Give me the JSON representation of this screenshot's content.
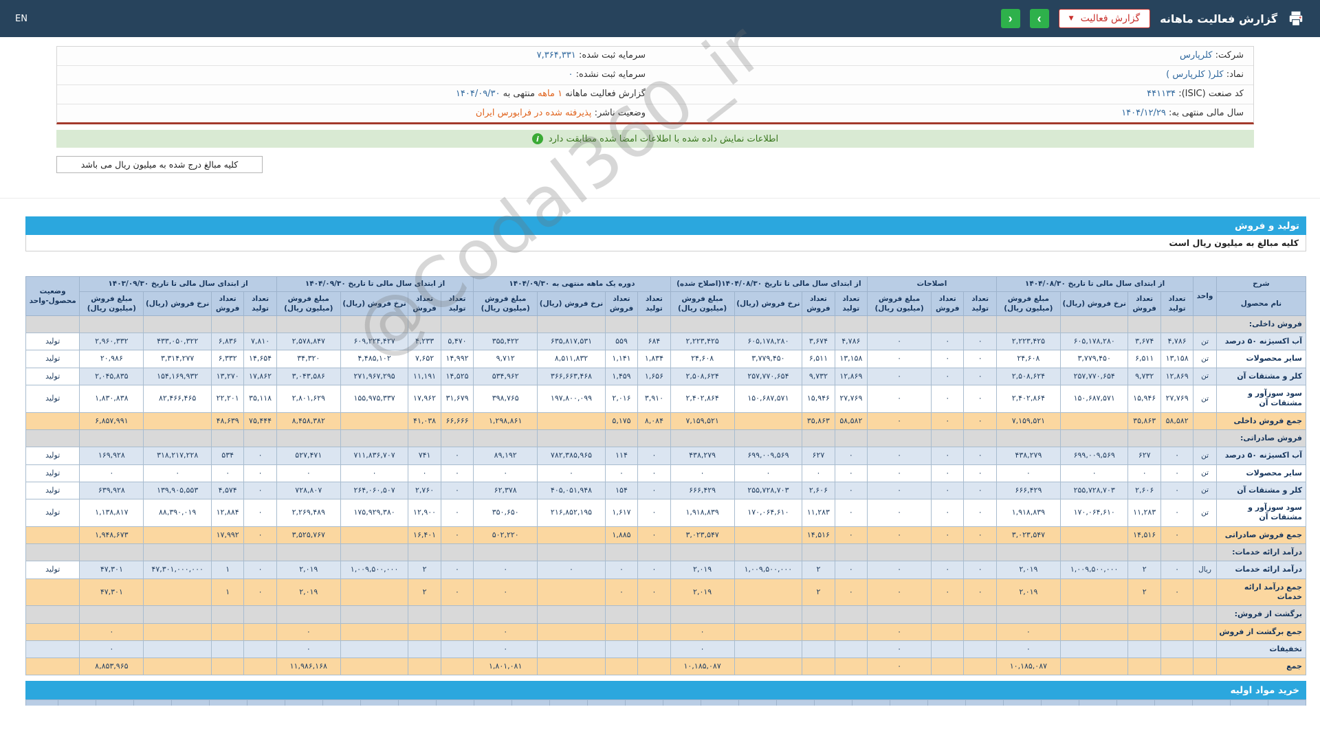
{
  "topbar": {
    "title": "گزارش فعالیت ماهانه",
    "report_select_label": "گزارش فعالیت",
    "caret": "▼",
    "nav_prev": "‹",
    "nav_next": "›",
    "lang_label": "EN"
  },
  "company": {
    "r1r_label": "شرکت:",
    "r1r_value": "کلرپارس",
    "r1l_label": "سرمایه ثبت شده:",
    "r1l_value": "۷,۳۶۴,۳۳۱",
    "r2r_label": "نماد:",
    "r2r_value": "کلر( کلرپارس )",
    "r2l_label": "سرمایه ثبت نشده:",
    "r2l_value": "۰",
    "r3r_label": "کد صنعت (ISIC):",
    "r3r_value": "۴۴۱۱۳۴",
    "r3l_prefix": "گزارش فعالیت ماهانه",
    "r3l_period": "۱ ماهه",
    "r3l_mid": "منتهی به",
    "r3l_value": "۱۴۰۴/۰۹/۳۰",
    "r4r_label": "سال مالی منتهی به:",
    "r4r_value": "۱۴۰۴/۱۲/۲۹",
    "r4l_label": "وضعیت ناشر:",
    "r4l_value": "پذیرفته شده در فرابورس ایران"
  },
  "notices": {
    "signed_match": "اطلاعات نمایش داده شده با اطلاعات امضا شده مطابقت دارد",
    "info_glyph": "i",
    "amounts_box": "کلیه مبالغ درج شده به میلیون ریال می باشد"
  },
  "production": {
    "title": "تولید و فروش",
    "note": "کلیه مبالغ به میلیون ریال است"
  },
  "purchase": {
    "title": "خرید مواد اولیه"
  },
  "watermark": "@Codal360_ir",
  "table": {
    "header": {
      "desc": "شرح",
      "product_name": "نام محصول",
      "unit": "واحد",
      "status": "وضعیت محصول-واحد",
      "sub": {
        "qty_prod": "تعداد تولید",
        "qty_sold": "تعداد فروش",
        "rate": "نرخ فروش (ریال)",
        "amount": "مبلغ فروش (میلیون ریال)"
      },
      "groups": [
        {
          "title": "از ابتدای سال مالی تا تاریخ ۱۴۰۴/۰۸/۳۰",
          "subs": [
            "qty_prod",
            "qty_sold",
            "rate",
            "amount"
          ]
        },
        {
          "title": "اصلاحات",
          "subs": [
            "qty_prod",
            "qty_sold",
            "amount"
          ]
        },
        {
          "title": "از ابتدای سال مالی تا تاریخ ۱۴۰۴/۰۸/۳۰(اصلاح شده)",
          "subs": [
            "qty_prod",
            "qty_sold",
            "rate",
            "amount"
          ]
        },
        {
          "title": "دوره یک ماهه منتهی به ۱۴۰۴/۰۹/۳۰",
          "subs": [
            "qty_prod",
            "qty_sold",
            "rate",
            "amount"
          ]
        },
        {
          "title": "از ابتدای سال مالی تا تاریخ ۱۴۰۴/۰۹/۳۰",
          "subs": [
            "qty_prod",
            "qty_sold",
            "rate",
            "amount"
          ]
        },
        {
          "title": "از ابتدای سال مالی تا تاریخ ۱۴۰۳/۰۹/۳۰",
          "subs": [
            "qty_prod",
            "qty_sold",
            "rate",
            "amount"
          ]
        }
      ]
    },
    "rows": [
      {
        "type": "section",
        "name": "فروش داخلی:"
      },
      {
        "type": "product",
        "shade": true,
        "name": "آب اکسیژنه ۵۰ درصد",
        "unit": "تن",
        "status": "تولید",
        "cells": [
          "۴,۷۸۶",
          "۳,۶۷۴",
          "۶۰۵,۱۷۸,۲۸۰",
          "۲,۲۲۳,۴۲۵",
          "۰",
          "۰",
          "۰",
          "۴,۷۸۶",
          "۳,۶۷۴",
          "۶۰۵,۱۷۸,۲۸۰",
          "۲,۲۲۳,۴۲۵",
          "۶۸۴",
          "۵۵۹",
          "۶۳۵,۸۱۷,۵۳۱",
          "۳۵۵,۴۲۲",
          "۵,۴۷۰",
          "۴,۲۳۳",
          "۶۰۹,۲۲۴,۴۲۷",
          "۲,۵۷۸,۸۴۷",
          "۷,۸۱۰",
          "۶,۸۳۶",
          "۴۳۳,۰۵۰,۳۲۲",
          "۲,۹۶۰,۳۳۲"
        ]
      },
      {
        "type": "product",
        "shade": false,
        "name": "سایر محصولات",
        "unit": "تن",
        "status": "تولید",
        "cells": [
          "۱۳,۱۵۸",
          "۶,۵۱۱",
          "۳,۷۷۹,۴۵۰",
          "۲۴,۶۰۸",
          "۰",
          "۰",
          "۰",
          "۱۳,۱۵۸",
          "۶,۵۱۱",
          "۳,۷۷۹,۴۵۰",
          "۲۴,۶۰۸",
          "۱,۸۳۴",
          "۱,۱۴۱",
          "۸,۵۱۱,۸۳۲",
          "۹,۷۱۲",
          "۱۴,۹۹۲",
          "۷,۶۵۲",
          "۴,۴۸۵,۱۰۲",
          "۳۴,۳۲۰",
          "۱۴,۶۵۴",
          "۶,۳۳۲",
          "۳,۳۱۴,۲۷۷",
          "۲۰,۹۸۶"
        ]
      },
      {
        "type": "product",
        "shade": true,
        "name": "کلر و مشتقات آن",
        "unit": "تن",
        "status": "تولید",
        "cells": [
          "۱۲,۸۶۹",
          "۹,۷۳۲",
          "۲۵۷,۷۷۰,۶۵۴",
          "۲,۵۰۸,۶۲۴",
          "۰",
          "۰",
          "۰",
          "۱۲,۸۶۹",
          "۹,۷۳۲",
          "۲۵۷,۷۷۰,۶۵۴",
          "۲,۵۰۸,۶۲۴",
          "۱,۶۵۶",
          "۱,۴۵۹",
          "۳۶۶,۶۶۳,۴۶۸",
          "۵۳۴,۹۶۲",
          "۱۴,۵۲۵",
          "۱۱,۱۹۱",
          "۲۷۱,۹۶۷,۲۹۵",
          "۳,۰۴۳,۵۸۶",
          "۱۷,۸۶۲",
          "۱۳,۲۷۰",
          "۱۵۴,۱۶۹,۹۳۲",
          "۲,۰۴۵,۸۳۵"
        ]
      },
      {
        "type": "product",
        "shade": false,
        "name": "سود سوزآور و مشتقات آن",
        "unit": "تن",
        "status": "تولید",
        "cells": [
          "۲۷,۷۶۹",
          "۱۵,۹۴۶",
          "۱۵۰,۶۸۷,۵۷۱",
          "۲,۴۰۲,۸۶۴",
          "۰",
          "۰",
          "۰",
          "۲۷,۷۶۹",
          "۱۵,۹۴۶",
          "۱۵۰,۶۸۷,۵۷۱",
          "۲,۴۰۲,۸۶۴",
          "۳,۹۱۰",
          "۲,۰۱۶",
          "۱۹۷,۸۰۰,۰۹۹",
          "۳۹۸,۷۶۵",
          "۳۱,۶۷۹",
          "۱۷,۹۶۲",
          "۱۵۵,۹۷۵,۳۳۷",
          "۲,۸۰۱,۶۲۹",
          "۳۵,۱۱۸",
          "۲۲,۲۰۱",
          "۸۲,۴۶۶,۴۶۵",
          "۱,۸۳۰,۸۳۸"
        ]
      },
      {
        "type": "total",
        "name": "جمع فروش داخلی",
        "cells": [
          "۵۸,۵۸۲",
          "۳۵,۸۶۳",
          "",
          "۷,۱۵۹,۵۲۱",
          "۰",
          "۰",
          "۰",
          "۵۸,۵۸۲",
          "۳۵,۸۶۳",
          "",
          "۷,۱۵۹,۵۲۱",
          "۸,۰۸۴",
          "۵,۱۷۵",
          "",
          "۱,۲۹۸,۸۶۱",
          "۶۶,۶۶۶",
          "۴۱,۰۳۸",
          "",
          "۸,۴۵۸,۳۸۲",
          "۷۵,۴۴۴",
          "۴۸,۶۳۹",
          "",
          "۶,۸۵۷,۹۹۱"
        ]
      },
      {
        "type": "section",
        "name": "فروش صادراتی:"
      },
      {
        "type": "product",
        "shade": true,
        "name": "آب اکسیژنه ۵۰ درصد",
        "unit": "تن",
        "status": "تولید",
        "cells": [
          "۰",
          "۶۲۷",
          "۶۹۹,۰۰۹,۵۶۹",
          "۴۳۸,۲۷۹",
          "۰",
          "۰",
          "۰",
          "۰",
          "۶۲۷",
          "۶۹۹,۰۰۹,۵۶۹",
          "۴۳۸,۲۷۹",
          "۰",
          "۱۱۴",
          "۷۸۲,۳۸۵,۹۶۵",
          "۸۹,۱۹۲",
          "۰",
          "۷۴۱",
          "۷۱۱,۸۳۶,۷۰۷",
          "۵۲۷,۴۷۱",
          "۰",
          "۵۳۴",
          "۳۱۸,۲۱۷,۲۲۸",
          "۱۶۹,۹۲۸"
        ]
      },
      {
        "type": "product",
        "shade": false,
        "name": "سایر محصولات",
        "unit": "تن",
        "status": "تولید",
        "cells": [
          "۰",
          "۰",
          "۰",
          "۰",
          "۰",
          "۰",
          "۰",
          "۰",
          "۰",
          "۰",
          "۰",
          "۰",
          "۰",
          "۰",
          "۰",
          "۰",
          "۰",
          "۰",
          "۰",
          "۰",
          "۰",
          "۰",
          "۰"
        ]
      },
      {
        "type": "product",
        "shade": true,
        "name": "کلر و مشتقات آن",
        "unit": "تن",
        "status": "تولید",
        "cells": [
          "۰",
          "۲,۶۰۶",
          "۲۵۵,۷۲۸,۷۰۳",
          "۶۶۶,۴۲۹",
          "۰",
          "۰",
          "۰",
          "۰",
          "۲,۶۰۶",
          "۲۵۵,۷۲۸,۷۰۳",
          "۶۶۶,۴۲۹",
          "۰",
          "۱۵۴",
          "۴۰۵,۰۵۱,۹۴۸",
          "۶۲,۳۷۸",
          "۰",
          "۲,۷۶۰",
          "۲۶۴,۰۶۰,۵۰۷",
          "۷۲۸,۸۰۷",
          "۰",
          "۴,۵۷۴",
          "۱۳۹,۹۰۵,۵۵۳",
          "۶۳۹,۹۲۸"
        ]
      },
      {
        "type": "product",
        "shade": false,
        "name": "سود سوزآور و مشتقات آن",
        "unit": "تن",
        "status": "تولید",
        "cells": [
          "۰",
          "۱۱,۲۸۳",
          "۱۷۰,۰۶۴,۶۱۰",
          "۱,۹۱۸,۸۳۹",
          "۰",
          "۰",
          "۰",
          "۰",
          "۱۱,۲۸۳",
          "۱۷۰,۰۶۴,۶۱۰",
          "۱,۹۱۸,۸۳۹",
          "۰",
          "۱,۶۱۷",
          "۲۱۶,۸۵۲,۱۹۵",
          "۳۵۰,۶۵۰",
          "۰",
          "۱۲,۹۰۰",
          "۱۷۵,۹۲۹,۳۸۰",
          "۲,۲۶۹,۴۸۹",
          "۰",
          "۱۲,۸۸۴",
          "۸۸,۳۹۰,۰۱۹",
          "۱,۱۳۸,۸۱۷"
        ]
      },
      {
        "type": "total",
        "name": "جمع فروش صادراتی",
        "cells": [
          "۰",
          "۱۴,۵۱۶",
          "",
          "۳,۰۲۳,۵۴۷",
          "۰",
          "۰",
          "۰",
          "۰",
          "۱۴,۵۱۶",
          "",
          "۳,۰۲۳,۵۴۷",
          "۰",
          "۱,۸۸۵",
          "",
          "۵۰۲,۲۲۰",
          "۰",
          "۱۶,۴۰۱",
          "",
          "۳,۵۲۵,۷۶۷",
          "۰",
          "۱۷,۹۹۲",
          "",
          "۱,۹۴۸,۶۷۳"
        ]
      },
      {
        "type": "section",
        "name": "درآمد ارائه خدمات:"
      },
      {
        "type": "product",
        "shade": true,
        "name": "درآمد ارائه خدمات",
        "unit": "ریال",
        "status": "تولید",
        "cells": [
          "۰",
          "۲",
          "۱,۰۰۹,۵۰۰,۰۰۰",
          "۲,۰۱۹",
          "۰",
          "۰",
          "۰",
          "۰",
          "۲",
          "۱,۰۰۹,۵۰۰,۰۰۰",
          "۲,۰۱۹",
          "۰",
          "۰",
          "۰",
          "۰",
          "۰",
          "۲",
          "۱,۰۰۹,۵۰۰,۰۰۰",
          "۲,۰۱۹",
          "۰",
          "۱",
          "۴۷,۳۰۱,۰۰۰,۰۰۰",
          "۴۷,۳۰۱"
        ]
      },
      {
        "type": "total",
        "name": "جمع درآمد ارائه خدمات",
        "cells": [
          "۰",
          "۲",
          "",
          "۲,۰۱۹",
          "۰",
          "۰",
          "۰",
          "۰",
          "۲",
          "",
          "۲,۰۱۹",
          "۰",
          "۰",
          "",
          "۰",
          "۰",
          "۲",
          "",
          "۲,۰۱۹",
          "۰",
          "۱",
          "",
          "۴۷,۳۰۱"
        ]
      },
      {
        "type": "section",
        "name": "برگشت از فروش:"
      },
      {
        "type": "total",
        "name": "جمع برگشت از فروش",
        "cells": [
          "",
          "",
          "",
          "۰",
          "",
          "",
          "۰",
          "",
          "",
          "",
          "۰",
          "",
          "",
          "",
          "۰",
          "",
          "",
          "",
          "۰",
          "",
          "",
          "",
          "۰"
        ]
      },
      {
        "type": "product",
        "shade": true,
        "name": "تخفیفات",
        "unit": "",
        "status": "",
        "cells": [
          "",
          "",
          "",
          "۰",
          "",
          "",
          "۰",
          "",
          "",
          "",
          "۰",
          "",
          "",
          "",
          "۰",
          "",
          "",
          "",
          "۰",
          "",
          "",
          "",
          "۰"
        ]
      },
      {
        "type": "total",
        "name": "جمع",
        "cells": [
          "",
          "",
          "",
          "۱۰,۱۸۵,۰۸۷",
          "",
          "",
          "۰",
          "",
          "",
          "",
          "۱۰,۱۸۵,۰۸۷",
          "",
          "",
          "",
          "۱,۸۰۱,۰۸۱",
          "",
          "",
          "",
          "۱۱,۹۸۶,۱۶۸",
          "",
          "",
          "",
          "۸,۸۵۳,۹۶۵"
        ]
      }
    ]
  }
}
